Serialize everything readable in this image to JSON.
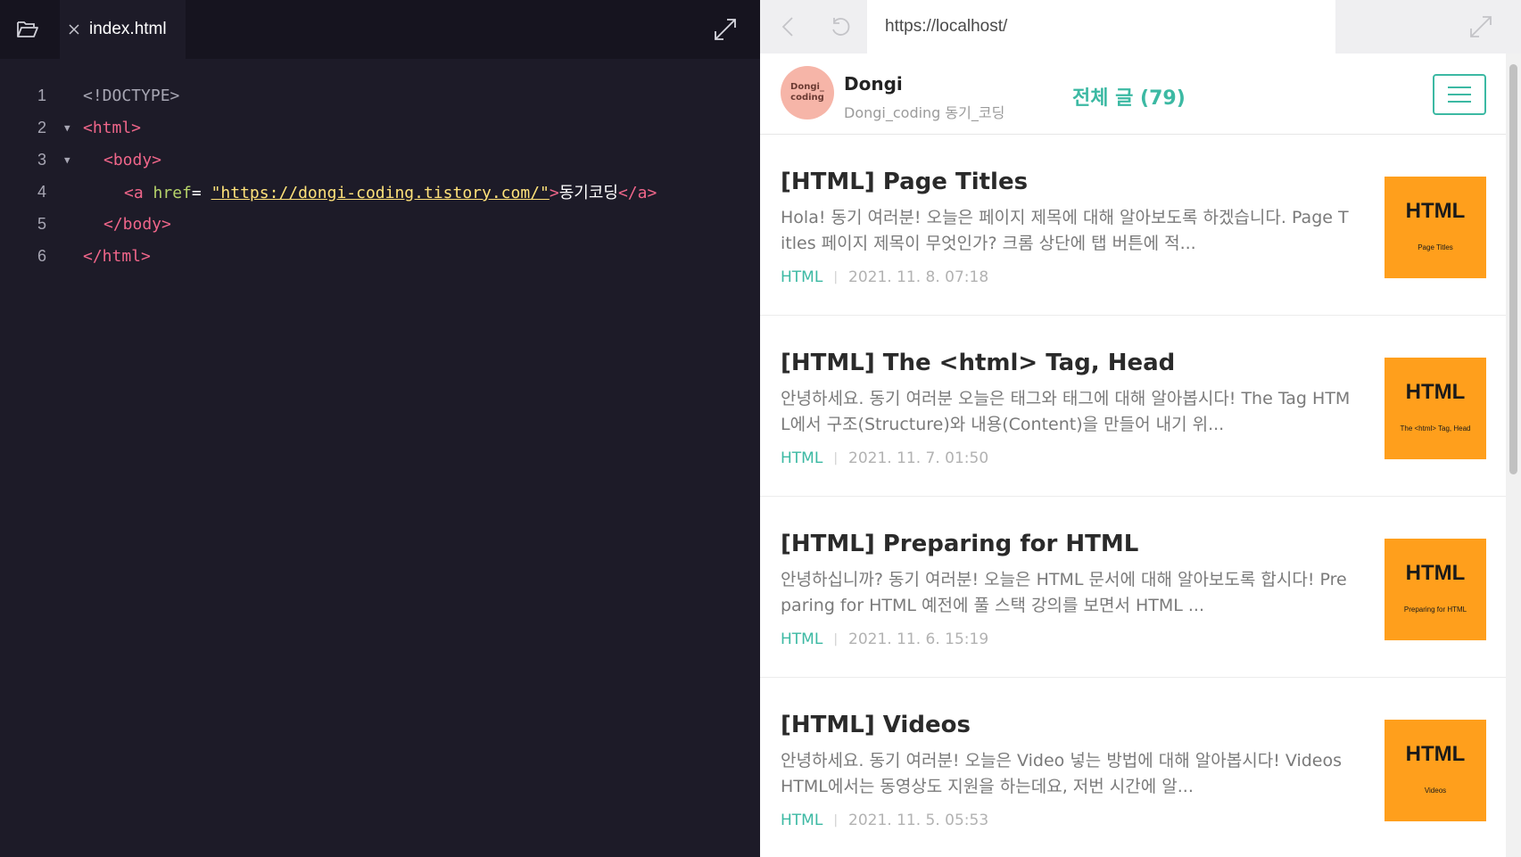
{
  "editor": {
    "folder_icon": "folder-open-icon",
    "tab": {
      "close_icon": "close-icon",
      "label": "index.html"
    },
    "expand_icon": "expand-icon",
    "lines": [
      {
        "number": "1",
        "doctype": "<!DOCTYPE>"
      },
      {
        "number": "2",
        "open": "<html>"
      },
      {
        "number": "3",
        "open": "<body>"
      },
      {
        "number": "4",
        "tag_open": "<a",
        "attr": " href",
        "eq": "= ",
        "value": "\"https://dongi-coding.tistory.com/\"",
        "tag_close": ">",
        "text": "동기코딩",
        "end_tag": "</a>"
      },
      {
        "number": "5",
        "close": "</body>"
      },
      {
        "number": "6",
        "close": "</html>"
      }
    ]
  },
  "browser": {
    "back_icon": "chevron-left-icon",
    "refresh_icon": "refresh-icon",
    "url": "https://localhost/",
    "expand_icon": "expand-icon"
  },
  "site": {
    "avatar": {
      "line1": "Dongi_",
      "line2": "coding"
    },
    "blog_name": "Dongi",
    "blog_desc": "Dongi_coding 동기_코딩",
    "total_posts": "전체 글 (79)",
    "menu_icon": "hamburger-menu-icon",
    "posts": [
      {
        "title": "[HTML] Page Titles",
        "excerpt": "Hola! 동기 여러분! 오늘은 페이지 제목에 대해 알아보도록 하겠습니다. Page Titles 페이지 제목이 무엇인가? 크롬 상단에 탭 버튼에 적...",
        "category": "HTML",
        "separator": "|",
        "date": "2021. 11. 8. 07:18",
        "thumb_title": "HTML",
        "thumb_sub": "Page Titles"
      },
      {
        "title": "[HTML] The <html> Tag, Head",
        "excerpt": "안녕하세요. 동기 여러분 오늘은 태그와 태그에 대해 알아봅시다! The Tag HTML에서 구조(Structure)와 내용(Content)을 만들어 내기 위...",
        "category": "HTML",
        "separator": "|",
        "date": "2021. 11. 7. 01:50",
        "thumb_title": "HTML",
        "thumb_sub": "The <html> Tag, Head"
      },
      {
        "title": "[HTML] Preparing for HTML",
        "excerpt": "안녕하십니까? 동기 여러분! 오늘은 HTML 문서에 대해 알아보도록 합시다! Preparing for HTML 예전에 풀 스택 강의를 보면서 HTML ...",
        "category": "HTML",
        "separator": "|",
        "date": "2021. 11. 6. 15:19",
        "thumb_title": "HTML",
        "thumb_sub": "Preparing for HTML"
      },
      {
        "title": "[HTML] Videos",
        "excerpt": "안녕하세요. 동기 여러분! 오늘은 Video 넣는 방법에 대해 알아봅시다! Videos HTML에서는 동영상도 지원을 하는데요, 저번 시간에 알...",
        "category": "HTML",
        "separator": "|",
        "date": "2021. 11. 5. 05:53",
        "thumb_title": "HTML",
        "thumb_sub": "Videos"
      }
    ]
  },
  "colors": {
    "editor_bg": "#1d1b28",
    "tag": "#f0668a",
    "attr": "#b6d36a",
    "string": "#ffe27a",
    "accent": "#3cb9a3",
    "thumb_bg": "#ff9f1c"
  }
}
